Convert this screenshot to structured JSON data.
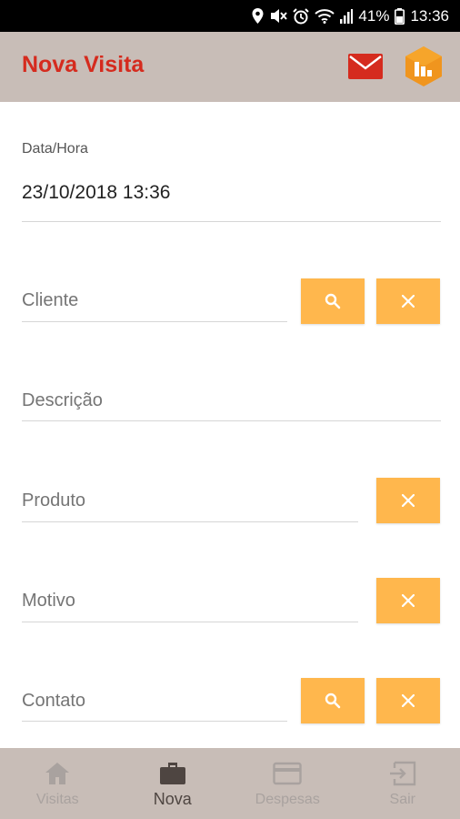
{
  "status_bar": {
    "battery": "41%",
    "time": "13:36",
    "icons": [
      "location-icon",
      "mute-icon",
      "alarm-icon",
      "wifi-icon",
      "signal-icon",
      "battery-icon"
    ]
  },
  "header": {
    "title": "Nova Visita",
    "icons": [
      "mail-icon",
      "app-logo"
    ],
    "colors": {
      "title": "#d52b1e",
      "background": "#c8bdb7",
      "mail": "#d52b1e",
      "logo": "#f0951e"
    }
  },
  "form": {
    "datahora": {
      "label": "Data/Hora",
      "value": "23/10/2018 13:36"
    },
    "cliente": {
      "placeholder": "Cliente",
      "value": ""
    },
    "descricao": {
      "placeholder": "Descrição",
      "value": ""
    },
    "produto": {
      "placeholder": "Produto",
      "value": ""
    },
    "motivo": {
      "placeholder": "Motivo",
      "value": ""
    },
    "contato": {
      "placeholder": "Contato",
      "value": ""
    },
    "button_color": "#ffb74d",
    "button_icons": [
      "search-icon",
      "close-icon"
    ]
  },
  "bottom_nav": {
    "items": [
      {
        "label": "Visitas",
        "icon": "home-icon",
        "active": false
      },
      {
        "label": "Nova",
        "icon": "briefcase-icon",
        "active": true
      },
      {
        "label": "Despesas",
        "icon": "credit-card-icon",
        "active": false
      },
      {
        "label": "Sair",
        "icon": "logout-icon",
        "active": false
      }
    ]
  }
}
